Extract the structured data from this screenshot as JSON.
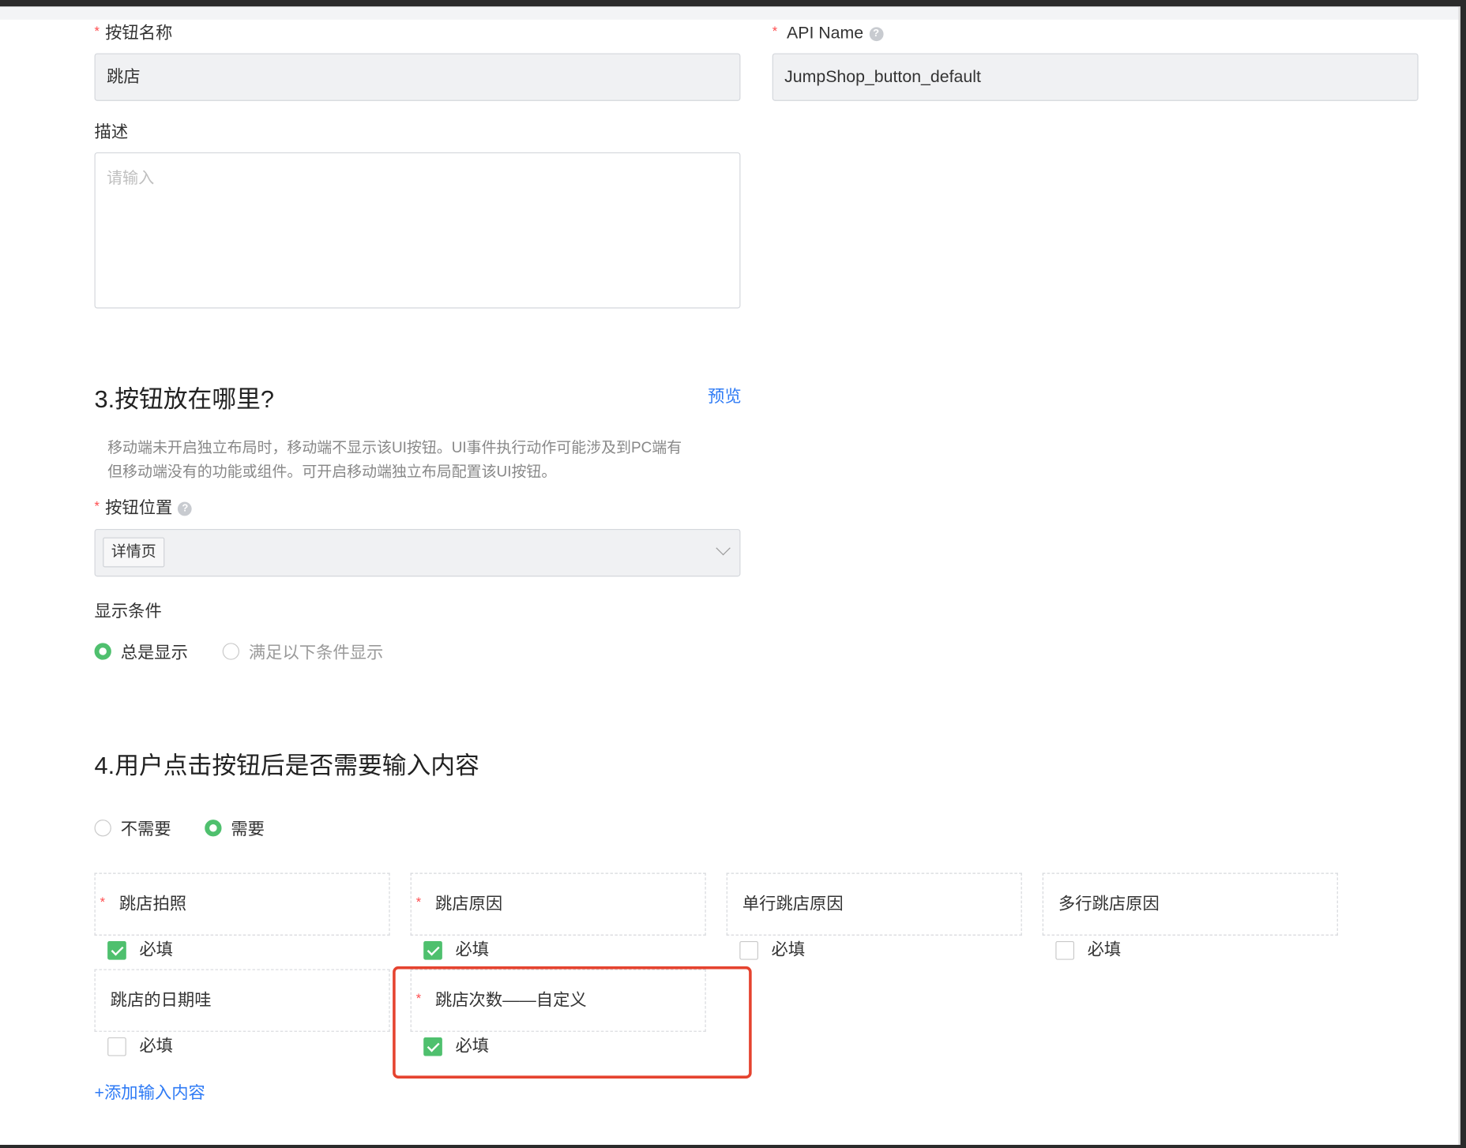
{
  "form": {
    "button_name_label": "按钮名称",
    "button_name_value": "跳店",
    "api_name_label": "API Name",
    "api_name_value": "JumpShop_button_default",
    "description_label": "描述",
    "description_placeholder": "请输入"
  },
  "section3": {
    "title": "3.按钮放在哪里?",
    "preview_link": "预览",
    "note_line1": "移动端未开启独立布局时，移动端不显示该UI按钮。UI事件执行动作可能涉及到PC端有",
    "note_line2": "但移动端没有的功能或组件。可开启移动端独立布局配置该UI按钮。",
    "position_label": "按钮位置",
    "position_tag": "详情页",
    "display_condition_label": "显示条件",
    "display_options": [
      "总是显示",
      "满足以下条件显示"
    ],
    "display_selected": 0
  },
  "section4": {
    "title": "4.用户点击按钮后是否需要输入内容",
    "input_options": [
      "不需要",
      "需要"
    ],
    "input_selected": 1,
    "required_label": "必填",
    "fields": [
      {
        "label": "跳店拍照",
        "required_mark": true,
        "required_checked": true
      },
      {
        "label": "跳店原因",
        "required_mark": true,
        "required_checked": true
      },
      {
        "label": "单行跳店原因",
        "required_mark": false,
        "required_checked": false
      },
      {
        "label": "多行跳店原因",
        "required_mark": false,
        "required_checked": false
      },
      {
        "label": "跳店的日期哇",
        "required_mark": false,
        "required_checked": false
      },
      {
        "label": "跳店次数——自定义",
        "required_mark": true,
        "required_checked": true
      }
    ],
    "add_input_link": "+添加输入内容"
  },
  "icons": {
    "help": "question-circle-icon",
    "dropdown": "chevron-down-icon",
    "check": "checkmark-icon"
  },
  "colors": {
    "accent_green": "#4fc06e",
    "link_blue": "#2f7bf5",
    "required_red": "#ff4d4f",
    "highlight_red": "#e5432f"
  }
}
